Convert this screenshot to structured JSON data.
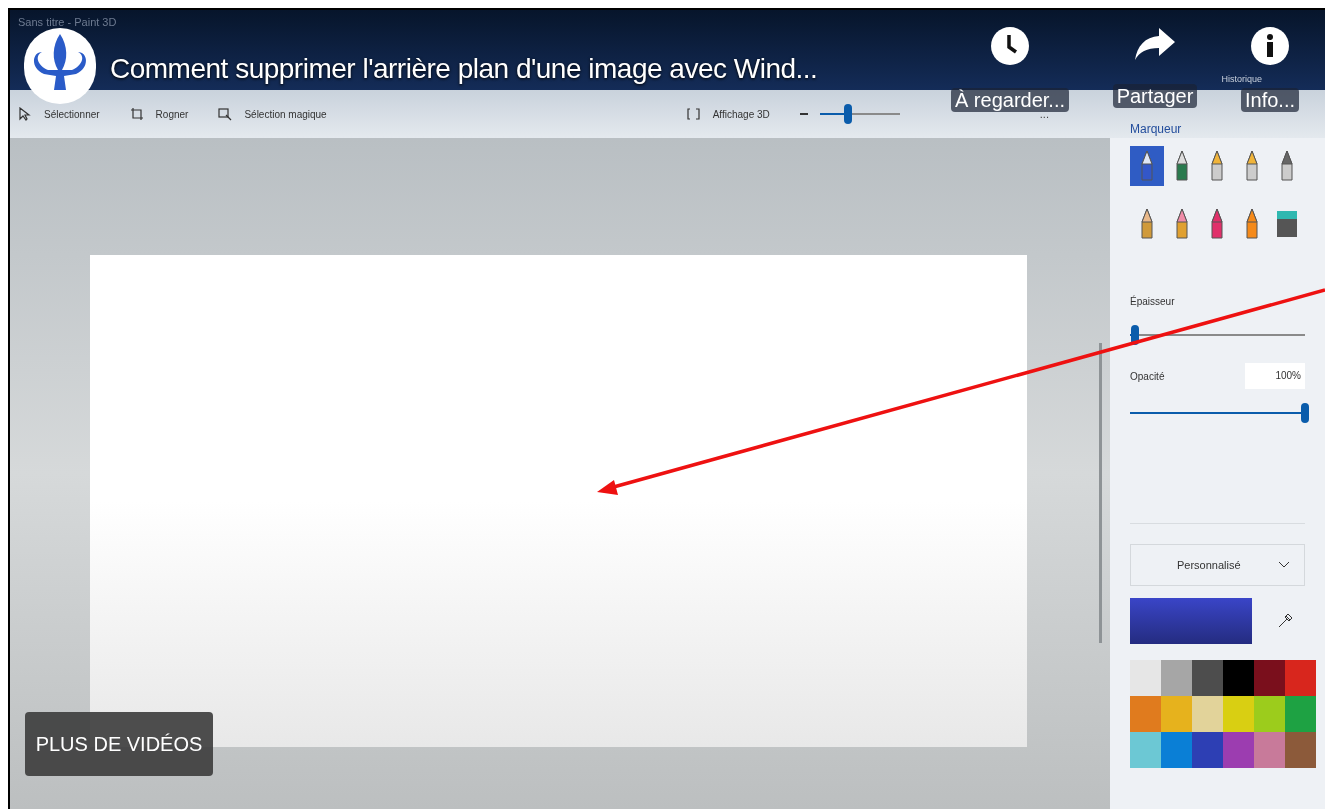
{
  "paint_window": {
    "title": "Sans titre - Paint 3D",
    "history_label": "Historique",
    "toolbar": [
      {
        "kind": "select",
        "label": "Sélectionner"
      },
      {
        "kind": "crop",
        "label": "Rogner"
      },
      {
        "kind": "magic",
        "label": "Sélection magique"
      },
      {
        "kind": "view3d",
        "label": "Affichage 3D"
      }
    ],
    "zoom": {
      "level": 0.35,
      "more": "..."
    },
    "side_panel": {
      "title": "Marqueur",
      "brushes": [
        {
          "kind": "marker",
          "selected": true
        },
        {
          "kind": "pen",
          "selected": false
        },
        {
          "kind": "oil",
          "selected": false
        },
        {
          "kind": "watercolor",
          "selected": false
        },
        {
          "kind": "pixel",
          "selected": false
        },
        {
          "kind": "pencil",
          "selected": false
        },
        {
          "kind": "eraser",
          "selected": false
        },
        {
          "kind": "crayon",
          "selected": false
        },
        {
          "kind": "spray",
          "selected": false
        },
        {
          "kind": "fill",
          "selected": false
        }
      ],
      "thickness": {
        "label": "Épaisseur",
        "level": 0.03
      },
      "opacity": {
        "label": "Opacité",
        "value": "100%",
        "level": 1
      },
      "palette_mode": "Personnalisé",
      "swatches": [
        {
          "color": "#e6e6e6"
        },
        {
          "color": "#a6a6a6"
        },
        {
          "color": "#4d4d4d"
        },
        {
          "color": "#000000"
        },
        {
          "color": "#7a0f1c"
        },
        {
          "color": "#d8261d"
        },
        {
          "color": "#e07b1e"
        },
        {
          "color": "#e6b21d"
        },
        {
          "color": "#e2d39a"
        },
        {
          "color": "#d9cf12"
        },
        {
          "color": "#9ccc1c"
        },
        {
          "color": "#1ea243"
        },
        {
          "color": "#6cc8d4"
        },
        {
          "color": "#0a7fd6"
        },
        {
          "color": "#2d3fb4"
        },
        {
          "color": "#9c3db0"
        },
        {
          "color": "#c87a9a"
        },
        {
          "color": "#8c5a3a"
        }
      ]
    }
  },
  "player": {
    "video_title": "Comment supprimer l'arrière plan d'une image avec Wind...",
    "actions": [
      {
        "kind": "watch_later",
        "label": "À regarder..."
      },
      {
        "kind": "share",
        "label": "Partager"
      },
      {
        "kind": "info",
        "label": "Info..."
      }
    ],
    "more_videos": "PLUS DE VIDÉOS"
  }
}
